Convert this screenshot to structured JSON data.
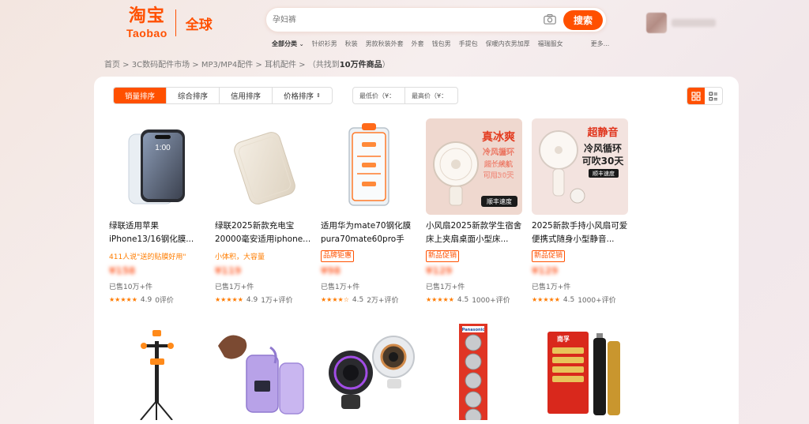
{
  "header": {
    "logo_cn": "淘宝",
    "logo_en": "Taobao",
    "logo_global": "全球",
    "search_placeholder": "孕妇裤",
    "search_button": "搜索"
  },
  "hot_keywords": {
    "all_label": "全部分类",
    "items": [
      "针织衫男",
      "秋装",
      "男款秋装外套",
      "外套",
      "钱包男",
      "手提包",
      "保暖内衣男加厚",
      "福瑞服女"
    ],
    "more": "更多..."
  },
  "breadcrumb": {
    "path": "首页 > 3C数码配件市场 > MP3/MP4配件 > 耳机配件 > （共找到",
    "count": "10万件商品",
    "suffix": "）"
  },
  "toolbar": {
    "sort_options": [
      "销量排序",
      "综合排序",
      "信用排序",
      "价格排序"
    ],
    "active_sort": "销量排序",
    "price_min_placeholder": "最低价（¥：",
    "price_max_placeholder": "最高价（¥：",
    "accent_color": "#ff5000"
  },
  "products": [
    {
      "title": "绿联适用苹果iPhone13/16钢化膜...",
      "subline": "411人说\"送的贴膜好用\"",
      "tag": "",
      "price": "¥158",
      "sold": "已售10万+件",
      "stars": "★★★★★",
      "score": "4.9",
      "reviews": "0评价",
      "image": "phone-screen-protector"
    },
    {
      "title": "绿联2025新款充电宝20000毫安适用iphone...",
      "subline": "小体积，大容量",
      "tag": "",
      "price": "¥119",
      "sold": "已售1万+件",
      "stars": "★★★★★",
      "score": "4.9",
      "reviews": "1万+评价",
      "image": "power-bank"
    },
    {
      "title": "适用华为mate70钢化膜pura70mate60pro手机...",
      "subline": "",
      "tag": "品牌钜惠",
      "price": "¥98",
      "sold": "已售1万+件",
      "stars": "★★★★☆",
      "score": "4.5",
      "reviews": "2万+评价",
      "image": "film-installer"
    },
    {
      "title": "小风扇2025新款学生宿舍床上夹扇桌面小型床...",
      "subline": "",
      "tag": "新品促销",
      "price": "¥129",
      "sold": "已售1万+件",
      "stars": "★★★★★",
      "score": "4.5",
      "reviews": "1000+评价",
      "image": "clip-fan",
      "img_text": [
        "真冰爽",
        "冷风循环",
        "超长续航",
        "可用30天",
        "顺丰速度"
      ]
    },
    {
      "title": "2025新款手持小风扇可爱便携式随身小型静音...",
      "subline": "",
      "tag": "新品促销",
      "price": "¥129",
      "sold": "已售1万+件",
      "stars": "★★★★★",
      "score": "4.5",
      "reviews": "1000+评价",
      "image": "handheld-fan",
      "img_text": [
        "超静音",
        "冷风循环",
        "可吹30天",
        "顺丰速度"
      ]
    },
    {
      "image": "tripod-stand"
    },
    {
      "image": "purple-power-bank"
    },
    {
      "image": "webcam"
    },
    {
      "image": "panasonic-coin-batteries",
      "img_text": [
        "Panasonic"
      ]
    },
    {
      "image": "nanfu-aa-batteries",
      "img_text": [
        "南孚"
      ]
    }
  ]
}
